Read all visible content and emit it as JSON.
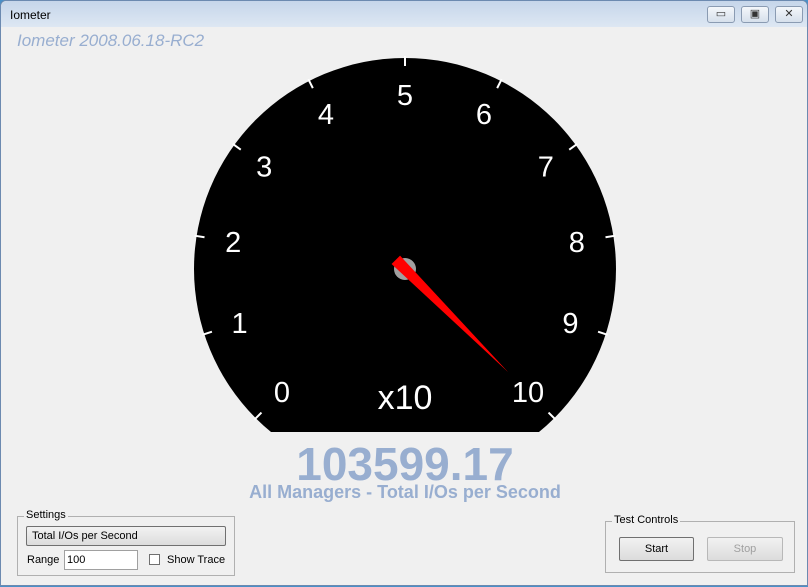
{
  "window": {
    "title": "Iometer",
    "min": "▭",
    "max": "▣",
    "close": "✕"
  },
  "version": "Iometer 2008.06.18-RC2",
  "gauge": {
    "labels": [
      "0",
      "1",
      "2",
      "3",
      "4",
      "5",
      "6",
      "7",
      "8",
      "9",
      "10"
    ],
    "multiplier": "x10",
    "needle_value": 10.0,
    "needle_color": "#ff0000"
  },
  "reading": {
    "value": "103599.17",
    "caption": "All Managers - Total I/Os per Second"
  },
  "settings": {
    "legend": "Settings",
    "metric": "Total I/Os per Second",
    "range_label": "Range",
    "range_value": "100",
    "show_trace": "Show Trace",
    "show_trace_checked": false
  },
  "test_controls": {
    "legend": "Test Controls",
    "start": "Start",
    "stop": "Stop"
  }
}
